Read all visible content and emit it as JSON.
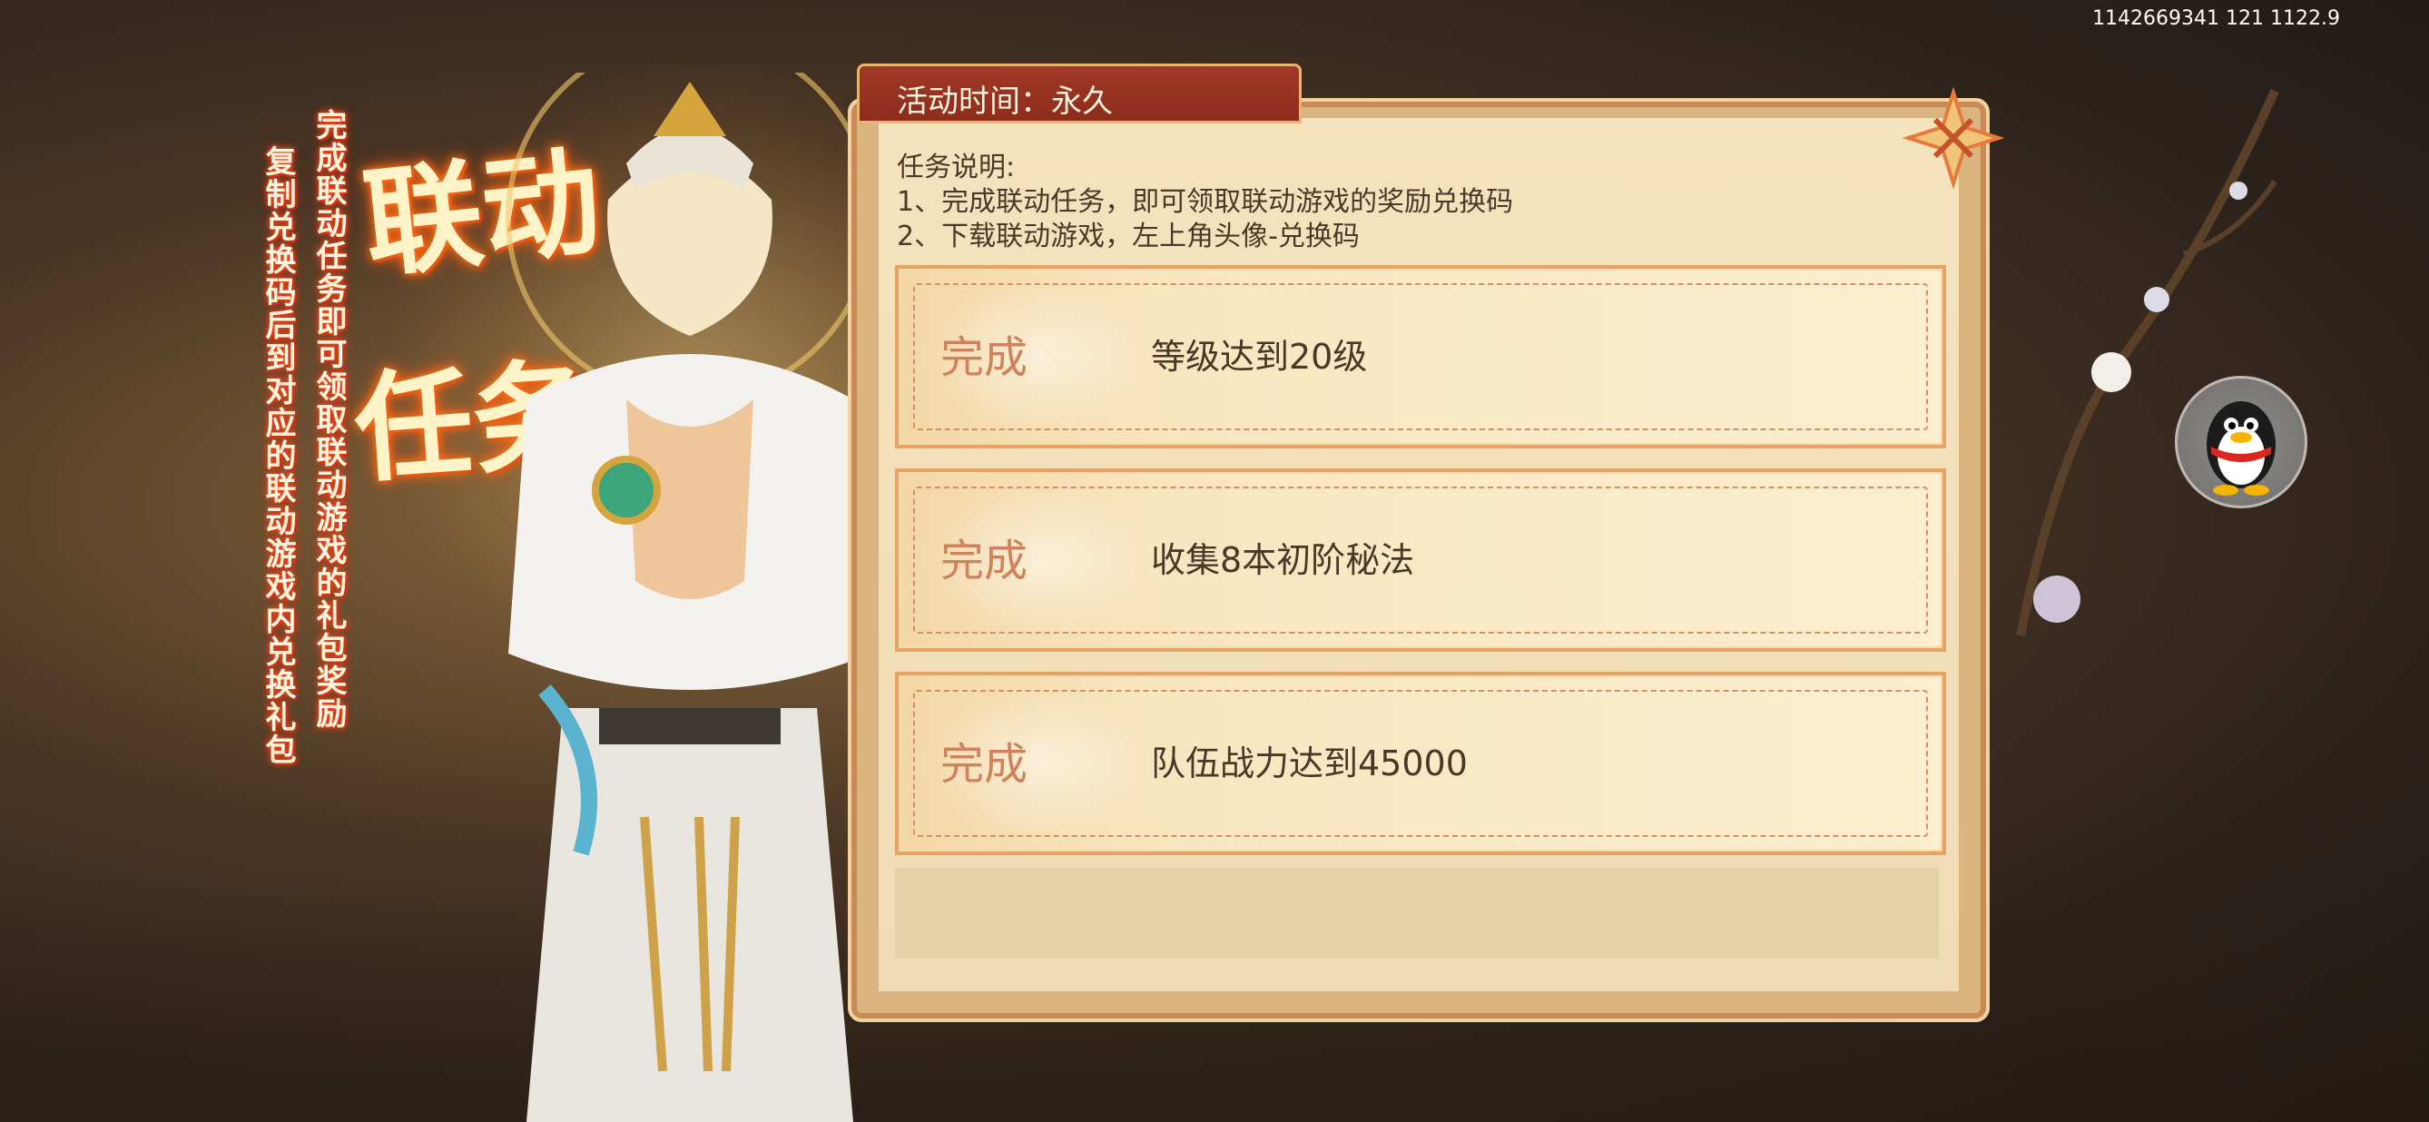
{
  "status_bar": {
    "text": "1142669341 121 1122.9"
  },
  "banner": {
    "title_line1": "联动",
    "title_line2": "任务",
    "subtitle_line1": "完成联动任务即可领取联动游戏的礼包奖励",
    "subtitle_line2": "复制兑换码后到对应的联动游戏内兑换礼包"
  },
  "panel": {
    "activity_time": "活动时间：永久",
    "description": {
      "heading": "任务说明:",
      "line1": "1、完成联动任务，即可领取联动游戏的奖励兑换码",
      "line2": "2、下载联动游戏，左上角头像-兑换码"
    },
    "tasks": [
      {
        "status": "完成",
        "text": "等级达到20级"
      },
      {
        "status": "完成",
        "text": "收集8本初阶秘法"
      },
      {
        "status": "完成",
        "text": "队伍战力达到45000"
      }
    ]
  },
  "side": {
    "qq_icon": "qq-penguin-icon",
    "close_icon": "close-icon"
  },
  "colors": {
    "accent": "#c98a58",
    "task_status": "#d0825c",
    "title_glow": "#ff5a10"
  }
}
